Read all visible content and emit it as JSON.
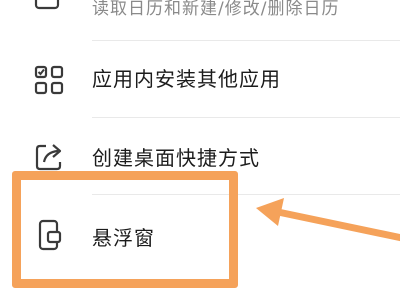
{
  "settings_list": {
    "items": [
      {
        "icon": "calendar-icon",
        "description": "读取日历和新建/修改/删除日历"
      },
      {
        "icon": "app-grid-icon",
        "label": "应用内安装其他应用"
      },
      {
        "icon": "share-shortcut-icon",
        "label": "创建桌面快捷方式"
      },
      {
        "icon": "floating-window-icon",
        "label": "悬浮窗"
      }
    ]
  },
  "annotation": {
    "highlight_color": "#f5a25a"
  }
}
